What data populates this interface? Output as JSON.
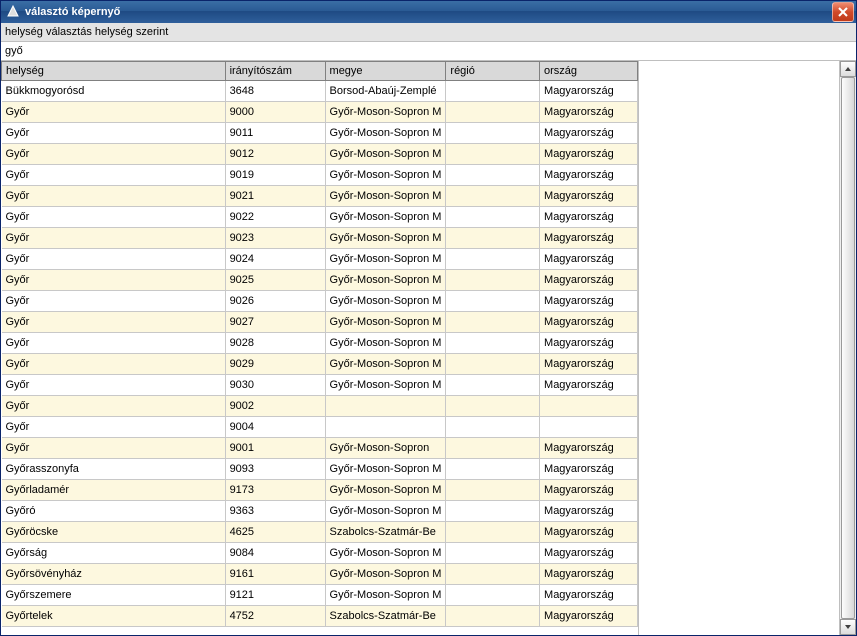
{
  "window": {
    "title": "választó képernyő",
    "subtitle": "helység választás helység szerint"
  },
  "search": {
    "value": "győ"
  },
  "columns": {
    "helyseg_label": "helység",
    "iranyitoszam_label": "irányítószám",
    "megye_label": "megye",
    "regio_label": "régió",
    "orszag_label": "ország",
    "widths": {
      "helyseg": 238,
      "iranyitoszam": 103,
      "megye": 102,
      "regio": 100,
      "orszag": 100
    }
  },
  "rows": [
    {
      "helyseg": "Bükkmogyorósd",
      "iranyitoszam": "3648",
      "megye": "Borsod-Abaúj-Zemplé",
      "regio": "",
      "orszag": "Magyarország"
    },
    {
      "helyseg": "Győr",
      "iranyitoszam": "9000",
      "megye": "Győr-Moson-Sopron M",
      "regio": "",
      "orszag": "Magyarország"
    },
    {
      "helyseg": "Győr",
      "iranyitoszam": "9011",
      "megye": "Győr-Moson-Sopron M",
      "regio": "",
      "orszag": "Magyarország"
    },
    {
      "helyseg": "Győr",
      "iranyitoszam": "9012",
      "megye": "Győr-Moson-Sopron M",
      "regio": "",
      "orszag": "Magyarország"
    },
    {
      "helyseg": "Győr",
      "iranyitoszam": "9019",
      "megye": "Győr-Moson-Sopron M",
      "regio": "",
      "orszag": "Magyarország"
    },
    {
      "helyseg": "Győr",
      "iranyitoszam": "9021",
      "megye": "Győr-Moson-Sopron M",
      "regio": "",
      "orszag": "Magyarország"
    },
    {
      "helyseg": "Győr",
      "iranyitoszam": "9022",
      "megye": "Győr-Moson-Sopron M",
      "regio": "",
      "orszag": "Magyarország"
    },
    {
      "helyseg": "Győr",
      "iranyitoszam": "9023",
      "megye": "Győr-Moson-Sopron M",
      "regio": "",
      "orszag": "Magyarország"
    },
    {
      "helyseg": "Győr",
      "iranyitoszam": "9024",
      "megye": "Győr-Moson-Sopron M",
      "regio": "",
      "orszag": "Magyarország"
    },
    {
      "helyseg": "Győr",
      "iranyitoszam": "9025",
      "megye": "Győr-Moson-Sopron M",
      "regio": "",
      "orszag": "Magyarország"
    },
    {
      "helyseg": "Győr",
      "iranyitoszam": "9026",
      "megye": "Győr-Moson-Sopron M",
      "regio": "",
      "orszag": "Magyarország"
    },
    {
      "helyseg": "Győr",
      "iranyitoszam": "9027",
      "megye": "Győr-Moson-Sopron M",
      "regio": "",
      "orszag": "Magyarország"
    },
    {
      "helyseg": "Győr",
      "iranyitoszam": "9028",
      "megye": "Győr-Moson-Sopron M",
      "regio": "",
      "orszag": "Magyarország"
    },
    {
      "helyseg": "Győr",
      "iranyitoszam": "9029",
      "megye": "Győr-Moson-Sopron M",
      "regio": "",
      "orszag": "Magyarország"
    },
    {
      "helyseg": "Győr",
      "iranyitoszam": "9030",
      "megye": "Győr-Moson-Sopron M",
      "regio": "",
      "orszag": "Magyarország"
    },
    {
      "helyseg": "Győr",
      "iranyitoszam": "9002",
      "megye": "",
      "regio": "",
      "orszag": ""
    },
    {
      "helyseg": "Győr",
      "iranyitoszam": "9004",
      "megye": "",
      "regio": "",
      "orszag": ""
    },
    {
      "helyseg": "Győr",
      "iranyitoszam": "9001",
      "megye": "Győr-Moson-Sopron",
      "regio": "",
      "orszag": "Magyarország"
    },
    {
      "helyseg": "Győrasszonyfa",
      "iranyitoszam": "9093",
      "megye": "Győr-Moson-Sopron M",
      "regio": "",
      "orszag": "Magyarország"
    },
    {
      "helyseg": "Győrladamér",
      "iranyitoszam": "9173",
      "megye": "Győr-Moson-Sopron M",
      "regio": "",
      "orszag": "Magyarország"
    },
    {
      "helyseg": "Győró",
      "iranyitoszam": "9363",
      "megye": "Győr-Moson-Sopron M",
      "regio": "",
      "orszag": "Magyarország"
    },
    {
      "helyseg": "Győröcske",
      "iranyitoszam": "4625",
      "megye": "Szabolcs-Szatmár-Be",
      "regio": "",
      "orszag": "Magyarország"
    },
    {
      "helyseg": "Győrság",
      "iranyitoszam": "9084",
      "megye": "Győr-Moson-Sopron M",
      "regio": "",
      "orszag": "Magyarország"
    },
    {
      "helyseg": "Győrsövényház",
      "iranyitoszam": "9161",
      "megye": "Győr-Moson-Sopron M",
      "regio": "",
      "orszag": "Magyarország"
    },
    {
      "helyseg": "Győrszemere",
      "iranyitoszam": "9121",
      "megye": "Győr-Moson-Sopron M",
      "regio": "",
      "orszag": "Magyarország"
    },
    {
      "helyseg": "Győrtelek",
      "iranyitoszam": "4752",
      "megye": "Szabolcs-Szatmár-Be",
      "regio": "",
      "orszag": "Magyarország"
    }
  ]
}
